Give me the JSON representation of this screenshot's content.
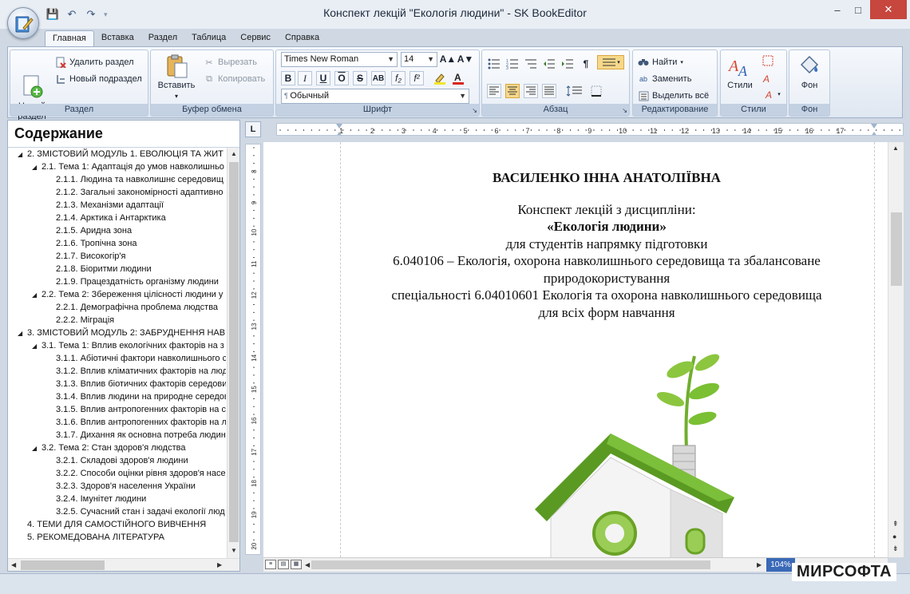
{
  "window": {
    "title": "Конспект лекцій \"Екологія людини\" - SK BookEditor",
    "minimize": "–",
    "maximize": "□",
    "close": "✕"
  },
  "quick_access": {
    "save": "💾",
    "undo": "↶",
    "redo": "↷",
    "more": "▾"
  },
  "tabs": [
    "Главная",
    "Вставка",
    "Раздел",
    "Таблица",
    "Сервис",
    "Справка"
  ],
  "ribbon": {
    "section_group": {
      "label": "Раздел",
      "new_section": "Новый\nраздел",
      "delete_section": "Удалить раздел",
      "new_subsection": "Новый подраздел"
    },
    "clipboard_group": {
      "label": "Буфер обмена",
      "paste": "Вставить",
      "cut": "Вырезать",
      "copy": "Копировать"
    },
    "font_group": {
      "label": "Шрифт",
      "font_name": "Times New Roman",
      "font_size": "14",
      "style": "Обычный",
      "bold": "B",
      "italic": "I",
      "underline": "U",
      "overline": "O",
      "strike": "S",
      "caps": "AB",
      "sub": "f₂",
      "sup": "f²",
      "grow": "A▲",
      "shrink": "A▼"
    },
    "paragraph_group": {
      "label": "Абзац"
    },
    "editing_group": {
      "label": "Редактирование",
      "find": "Найти",
      "replace": "Заменить",
      "select_all": "Выделить всё"
    },
    "styles_group": {
      "label": "Стили",
      "styles": "Стили"
    },
    "background_group": {
      "label": "Фон",
      "background": "Фон"
    }
  },
  "contents": {
    "title": "Содержание",
    "items": [
      {
        "level": 0,
        "exp": "◢",
        "text": "2. ЗМІСТОВИЙ МОДУЛЬ 1. ЕВОЛЮЦІЯ ТА ЖИТ"
      },
      {
        "level": 1,
        "exp": "◢",
        "text": "2.1. Тема 1: Адаптація до умов навколишньо"
      },
      {
        "level": 2,
        "exp": "",
        "text": "2.1.1. Людина та навколишнє середовищ"
      },
      {
        "level": 2,
        "exp": "",
        "text": "2.1.2. Загальні закономірності адаптивно"
      },
      {
        "level": 2,
        "exp": "",
        "text": "2.1.3. Механізми адаптації"
      },
      {
        "level": 2,
        "exp": "",
        "text": "2.1.4. Арктика і Антарктика"
      },
      {
        "level": 2,
        "exp": "",
        "text": "2.1.5. Аридна зона"
      },
      {
        "level": 2,
        "exp": "",
        "text": "2.1.6. Тропічна зона"
      },
      {
        "level": 2,
        "exp": "",
        "text": "2.1.7. Високогір'я"
      },
      {
        "level": 2,
        "exp": "",
        "text": "2.1.8. Біоритми людини"
      },
      {
        "level": 2,
        "exp": "",
        "text": "2.1.9. Працездатність організму людини"
      },
      {
        "level": 1,
        "exp": "◢",
        "text": "2.2. Тема 2: Збереження цілісності людини у"
      },
      {
        "level": 2,
        "exp": "",
        "text": "2.2.1. Демографічна проблема людства"
      },
      {
        "level": 2,
        "exp": "",
        "text": "2.2.2. Міграція"
      },
      {
        "level": 0,
        "exp": "◢",
        "text": "3. ЗМІСТОВИЙ МОДУЛЬ 2: ЗАБРУДНЕННЯ НАВ"
      },
      {
        "level": 1,
        "exp": "◢",
        "text": "3.1. Тема 1: Вплив екологічних факторів на з"
      },
      {
        "level": 2,
        "exp": "",
        "text": "3.1.1. Абіотичні фактори навколишнього с"
      },
      {
        "level": 2,
        "exp": "",
        "text": "3.1.2. Вплив кліматичних факторів на люд"
      },
      {
        "level": 2,
        "exp": "",
        "text": "3.1.3. Вплив біотичних факторів середови"
      },
      {
        "level": 2,
        "exp": "",
        "text": "3.1.4. Вплив людини на природне середов"
      },
      {
        "level": 2,
        "exp": "",
        "text": "3.1.5. Вплив антропогенних факторів на с"
      },
      {
        "level": 2,
        "exp": "",
        "text": "3.1.6. Вплив антропогенних факторів на л"
      },
      {
        "level": 2,
        "exp": "",
        "text": "3.1.7. Дихання як основна потреба людин"
      },
      {
        "level": 1,
        "exp": "◢",
        "text": "3.2. Тема 2: Стан здоров'я людства"
      },
      {
        "level": 2,
        "exp": "",
        "text": "3.2.1. Складові здоров'я людини"
      },
      {
        "level": 2,
        "exp": "",
        "text": "3.2.2. Способи оцінки рівня здоров'я насе"
      },
      {
        "level": 2,
        "exp": "",
        "text": "3.2.3. Здоров'я населення України"
      },
      {
        "level": 2,
        "exp": "",
        "text": "3.2.4. Імунітет людини"
      },
      {
        "level": 2,
        "exp": "",
        "text": "3.2.5. Сучасний стан і задачі екології люд"
      },
      {
        "level": 0,
        "exp": "",
        "text": "4. ТЕМИ ДЛЯ САМОСТІЙНОГО ВИВЧЕННЯ"
      },
      {
        "level": 0,
        "exp": "",
        "text": "5. РЕКОМЕДОВАНА ЛІТЕРАТУРА"
      }
    ]
  },
  "ruler": {
    "corner": "L",
    "h_numbers": [
      "1",
      "2",
      "3",
      "4",
      "5",
      "6",
      "7",
      "8",
      "9",
      "10",
      "11",
      "12",
      "13",
      "14",
      "15",
      "16",
      "17"
    ],
    "v_numbers": [
      "8",
      "9",
      "10",
      "11",
      "12",
      "13",
      "14",
      "15",
      "16",
      "17",
      "18",
      "19",
      "20"
    ]
  },
  "document": {
    "author": "ВАСИЛЕНКО ІННА АНАТОЛІЇВНА",
    "line1": "Конспект лекцій з дисципліни:",
    "line2": "«Екологія людини»",
    "line3": "для студентів напрямку підготовки",
    "line4": "6.040106 – Екологія, охорона навколишнього середовища та збалансоване",
    "line5": "природокористування",
    "line6": "спеціальності 6.04010601 Екологія та охорона навколишнього середовища",
    "line7": "для всіх форм навчання"
  },
  "status": {
    "zoom": "104%"
  },
  "watermark": "МИРСОФТА"
}
